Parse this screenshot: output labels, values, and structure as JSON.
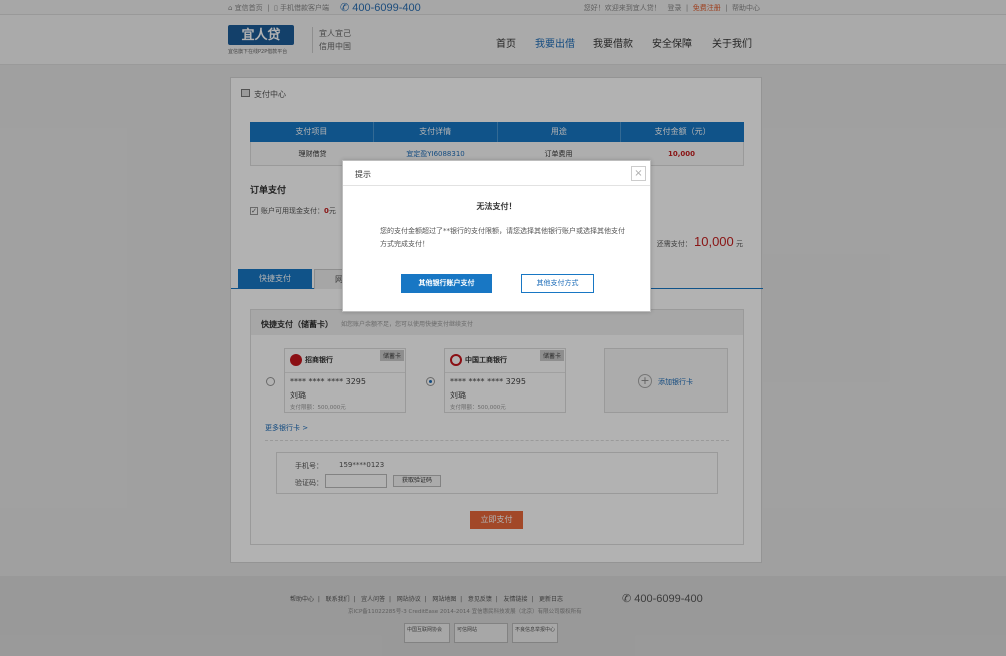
{
  "topbar": {
    "home_link": "宜信首页",
    "mobile_link": "手机借款客户端",
    "phone": "400-6099-400",
    "welcome": "您好！欢迎来到宜人贷！",
    "login": "登录",
    "register": "免费注册",
    "help": "帮助中心"
  },
  "header": {
    "logo": "宜人贷",
    "logo_sub": "宜信旗下在线P2P借款平台",
    "slogan_line1": "宜人宜己",
    "slogan_line2": "信用中国",
    "nav": [
      "首页",
      "我要出借",
      "我要借款",
      "安全保障",
      "关于我们"
    ],
    "nav_active_index": 1
  },
  "payment": {
    "section_title": "支付中心",
    "table_headers": [
      "支付项目",
      "支付详情",
      "用途",
      "支付金额（元）"
    ],
    "table_row": [
      "理财借贷",
      "宜定盈YI6088310",
      "订单费用",
      "10,000"
    ],
    "order_title": "订单支付",
    "balance_label": "账户可用现金支付：",
    "balance_value": "0",
    "balance_unit": "元",
    "due_label": "还需支付：",
    "due_amount": "10,000",
    "due_unit": "元"
  },
  "tabs": {
    "quick": "快捷支付",
    "online": "网"
  },
  "quick_pay": {
    "title": "快捷支付（储蓄卡）",
    "tip": "如您账户余额不足，您可以使用快捷支付继续支付",
    "cards": [
      {
        "bank": "招商银行",
        "tag": "储蓄卡",
        "number": "**** **** **** 3295",
        "holder": "刘璐",
        "limit": "支付限额：500,000元",
        "selected": false
      },
      {
        "bank": "中国工商银行",
        "tag": "储蓄卡",
        "number": "**** **** **** 3295",
        "holder": "刘璐",
        "limit": "支付限额：500,000元",
        "selected": true
      }
    ],
    "add_card": "添加银行卡",
    "more_cards": "更多银行卡 >",
    "phone_label": "手机号：",
    "phone_value": "159****0123",
    "code_label": "验证码：",
    "code_button": "获取验证码",
    "pay_now": "立即支付"
  },
  "footer": {
    "links": [
      "帮助中心",
      "联系我们",
      "宜人问答",
      "网站协议",
      "网站地图",
      "意见反馈",
      "友情链接",
      "更新日志"
    ],
    "phone": "400-6099-400",
    "copyright": "京ICP备11022285号-3 CreditEase 2014-2014  宜信惠民科技发展（北京）有限公司版权所有",
    "badges": [
      "中国互联网协会",
      "可信网站",
      "不良信息举报中心"
    ]
  },
  "dialog": {
    "title": "提示",
    "close": "×",
    "heading": "无法支付！",
    "message": "您的支付金额超过了**银行的支付限额，请您选择其他银行账户或选择其他支付方式完成支付！",
    "primary_button": "其他银行账户支付",
    "secondary_button": "其他支付方式"
  },
  "colors": {
    "primary": "#1877c4",
    "accent": "#e8683a",
    "amount": "#c51f1f"
  }
}
